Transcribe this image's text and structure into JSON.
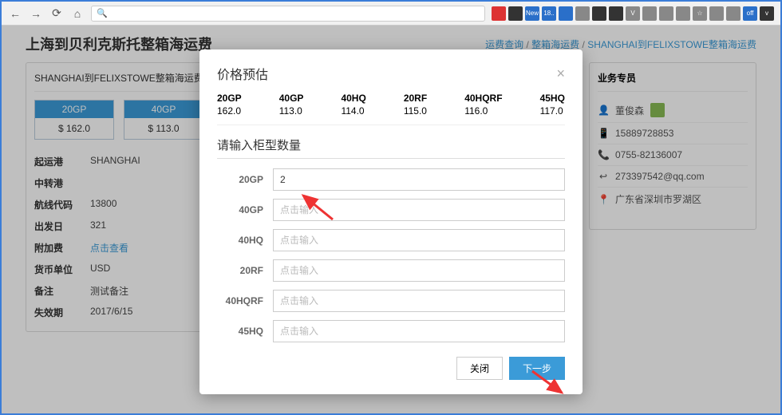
{
  "browser": {
    "url_hint": "🔍"
  },
  "header": {
    "title": "上海到贝利克斯托整箱海运费",
    "crumb1": "运费查询",
    "crumb2": "整箱海运费",
    "crumb3": "SHANGHAI到FELIXSTOWE整箱海运费"
  },
  "left_card": {
    "title": "SHANGHAI到FELIXSTOWE整箱海运费",
    "boxes": [
      {
        "code": "20GP",
        "price": "$ 162.0"
      },
      {
        "code": "40GP",
        "price": "$ 113.0"
      }
    ],
    "rows": [
      {
        "label": "起运港",
        "value": "SHANGHAI"
      },
      {
        "label": "中转港",
        "value": ""
      },
      {
        "label": "航线代码",
        "value": "13800"
      },
      {
        "label": "出发日",
        "value": "321"
      },
      {
        "label": "附加费",
        "value": "点击查看",
        "link": true
      },
      {
        "label": "货币单位",
        "value": "USD"
      },
      {
        "label": "备注",
        "value": "测试备注"
      },
      {
        "label": "失效期",
        "value": "2017/6/15"
      }
    ]
  },
  "right_card": {
    "title": "业务专员",
    "name": "董俊森",
    "rows": [
      {
        "icon": "📱",
        "text": "15889728853"
      },
      {
        "icon": "📞",
        "text": "0755-82136007"
      },
      {
        "icon": "↩",
        "text": "273397542@qq.com"
      },
      {
        "icon": "📍",
        "text": "广东省深圳市罗湖区"
      }
    ]
  },
  "modal": {
    "title": "价格预估",
    "prices": [
      {
        "code": "20GP",
        "val": "162.0"
      },
      {
        "code": "40GP",
        "val": "113.0"
      },
      {
        "code": "40HQ",
        "val": "114.0"
      },
      {
        "code": "20RF",
        "val": "115.0"
      },
      {
        "code": "40HQRF",
        "val": "116.0"
      },
      {
        "code": "45HQ",
        "val": "117.0"
      }
    ],
    "section": "请输入柜型数量",
    "placeholder": "点击输入",
    "fields": [
      {
        "label": "20GP",
        "value": "2"
      },
      {
        "label": "40GP",
        "value": ""
      },
      {
        "label": "40HQ",
        "value": ""
      },
      {
        "label": "20RF",
        "value": ""
      },
      {
        "label": "40HQRF",
        "value": ""
      },
      {
        "label": "45HQ",
        "value": ""
      }
    ],
    "btn_close": "关闭",
    "btn_next": "下一步"
  }
}
